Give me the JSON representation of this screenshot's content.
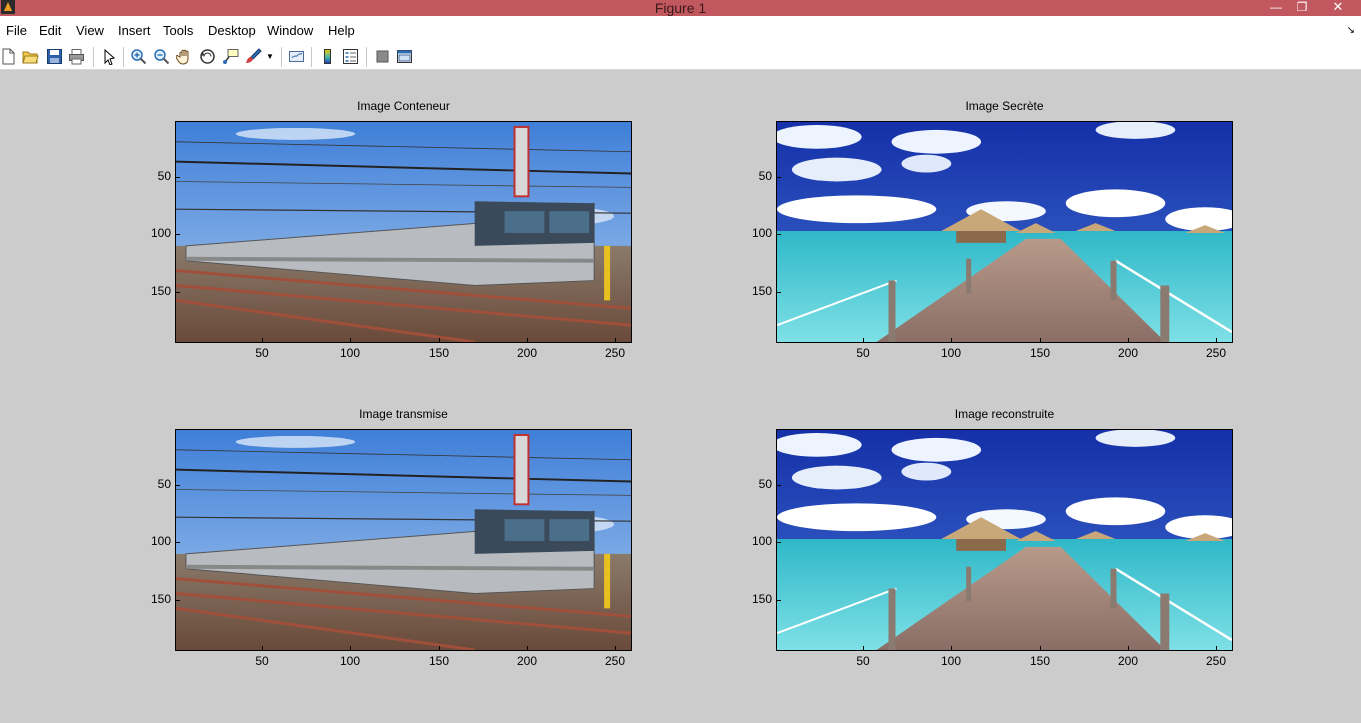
{
  "window": {
    "title": "Figure 1",
    "minimize_glyph": "—",
    "maximize_glyph": "❐",
    "close_glyph": "✕"
  },
  "menu": [
    "File",
    "Edit",
    "View",
    "Insert",
    "Tools",
    "Desktop",
    "Window",
    "Help"
  ],
  "toolbar": {
    "icons": [
      "new-figure-icon",
      "open-file-icon",
      "save-icon",
      "print-icon",
      "edit-plot-icon",
      "zoom-in-icon",
      "zoom-out-icon",
      "pan-icon",
      "rotate-3d-icon",
      "data-cursor-icon",
      "brush-icon",
      "link-plot-icon",
      "insert-colorbar-icon",
      "insert-legend-icon",
      "hide-plot-tools-icon",
      "show-plot-tools-icon"
    ]
  },
  "axes": [
    {
      "title": "Image Conteneur",
      "image": "train",
      "yticks": [
        "50",
        "100",
        "150"
      ],
      "xticks": [
        "50",
        "100",
        "150",
        "200",
        "250"
      ]
    },
    {
      "title": "Image Secrète",
      "image": "beach",
      "yticks": [
        "50",
        "100",
        "150"
      ],
      "xticks": [
        "50",
        "100",
        "150",
        "200",
        "250"
      ]
    },
    {
      "title": "Image transmise",
      "image": "train",
      "yticks": [
        "50",
        "100",
        "150"
      ],
      "xticks": [
        "50",
        "100",
        "150",
        "200",
        "250"
      ]
    },
    {
      "title": "Image reconstruite",
      "image": "beach",
      "yticks": [
        "50",
        "100",
        "150"
      ],
      "xticks": [
        "50",
        "100",
        "150",
        "200",
        "250"
      ]
    }
  ]
}
